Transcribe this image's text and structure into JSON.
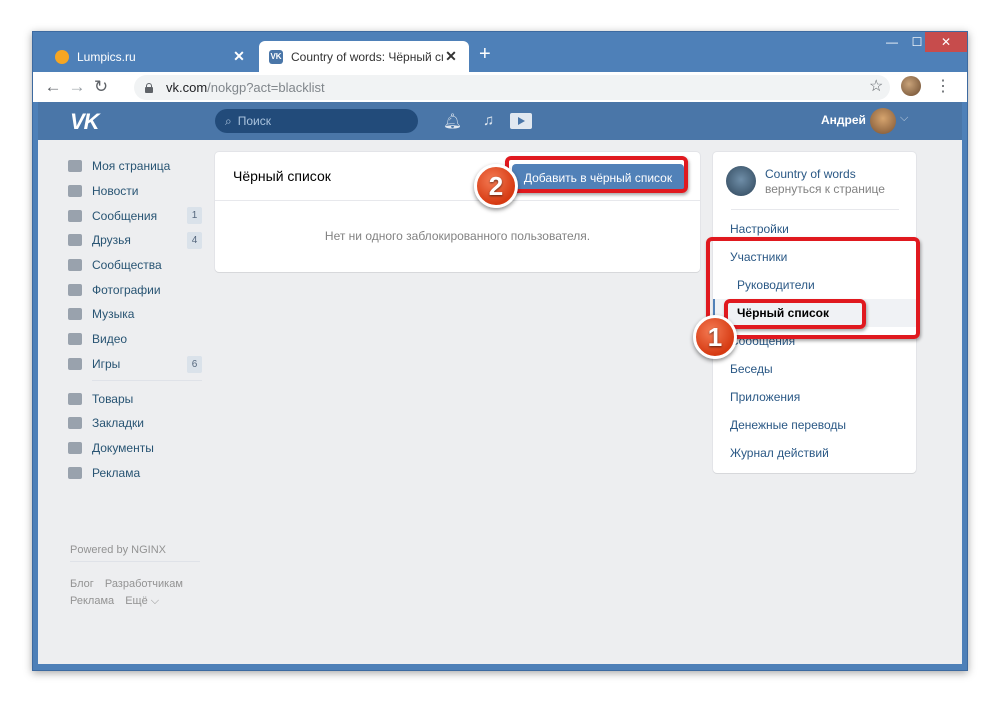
{
  "browser": {
    "tabs": [
      {
        "title": "Lumpics.ru",
        "close": "✕"
      },
      {
        "title": "Country of words: Чёрный списс",
        "close": "✕"
      }
    ],
    "new_tab": "+",
    "window_controls": {
      "minimize": "—",
      "maximize": "☐",
      "close": "✕"
    },
    "nav": {
      "back": "←",
      "forward": "→",
      "reload": "↻"
    },
    "url_host": "vk.com",
    "url_path": "/nokgp?act=blacklist",
    "star": "☆",
    "menu": "⋮"
  },
  "vk": {
    "logo": "VK",
    "search_placeholder": "Поиск",
    "user_name": "Андрей",
    "icons": {
      "bell": "bell-icon",
      "music": "music-icon",
      "video": "video-icon"
    }
  },
  "left_menu": {
    "items": [
      {
        "label": "Моя страница",
        "icon": "home-icon",
        "count": ""
      },
      {
        "label": "Новости",
        "icon": "news-icon",
        "count": ""
      },
      {
        "label": "Сообщения",
        "icon": "messages-icon",
        "count": "1"
      },
      {
        "label": "Друзья",
        "icon": "friends-icon",
        "count": "4"
      },
      {
        "label": "Сообщества",
        "icon": "groups-icon",
        "count": ""
      },
      {
        "label": "Фотографии",
        "icon": "photo-icon",
        "count": ""
      },
      {
        "label": "Музыка",
        "icon": "music-icon",
        "count": ""
      },
      {
        "label": "Видео",
        "icon": "video-icon",
        "count": ""
      },
      {
        "label": "Игры",
        "icon": "games-icon",
        "count": "6"
      }
    ],
    "items2": [
      {
        "label": "Товары",
        "icon": "goods-icon"
      },
      {
        "label": "Закладки",
        "icon": "bookmarks-icon"
      },
      {
        "label": "Документы",
        "icon": "documents-icon"
      },
      {
        "label": "Реклама",
        "icon": "ads-icon"
      }
    ],
    "powered": "Powered by NGINX",
    "footer": [
      [
        "Блог",
        "Разработчикам"
      ],
      [
        "Реклама",
        "Ещё ⌵"
      ]
    ]
  },
  "main": {
    "title": "Чёрный список",
    "add_button": "Добавить в чёрный список",
    "empty_text": "Нет ни одного заблокированного пользователя."
  },
  "right_menu": {
    "group_name": "Country of words",
    "back_link": "вернуться к странице",
    "items": [
      "Настройки",
      "Участники",
      "Руководители",
      "Чёрный список",
      "Сообщения",
      "Беседы",
      "Приложения",
      "Денежные переводы",
      "Журнал действий"
    ]
  },
  "annotations": {
    "step1": "1",
    "step2": "2",
    "color": "#e0191f"
  }
}
